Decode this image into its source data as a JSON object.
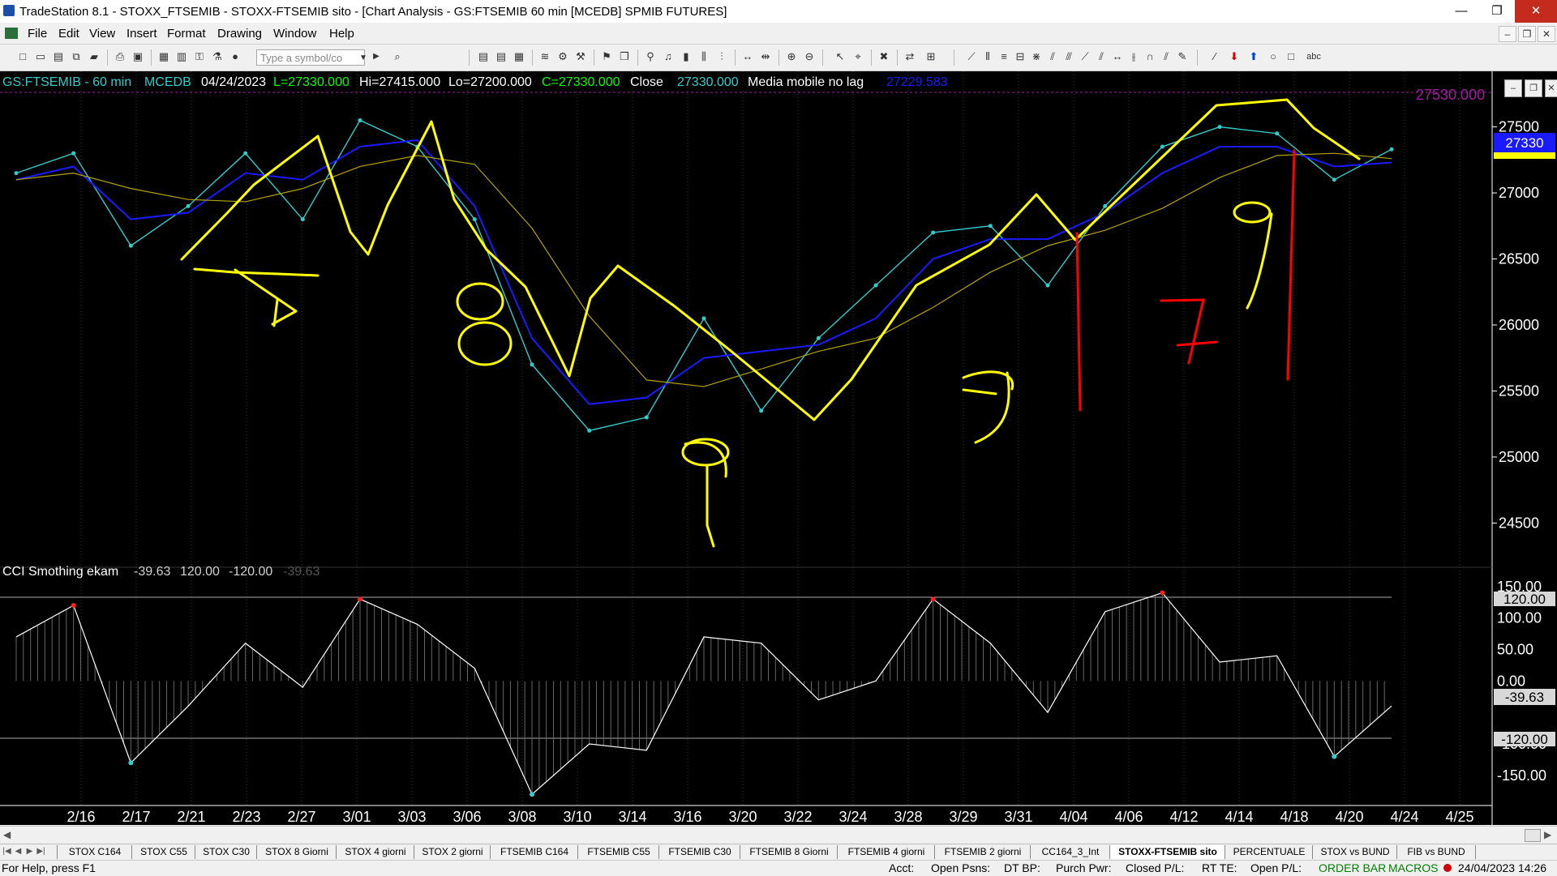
{
  "window": {
    "title": "TradeStation 8.1 - STOXX_FTSEMIB - STOXX-FTSEMIB sito - [Chart Analysis - GS:FTSEMIB  60 min  [MCEDB] SPMIB FUTURES]",
    "minimize": "—",
    "maximize": "❐",
    "close": "✕"
  },
  "menu": [
    "File",
    "Edit",
    "View",
    "Insert",
    "Format",
    "Drawing",
    "Window",
    "Help"
  ],
  "toolbar": {
    "symbol_placeholder": "Type a symbol/co",
    "text_tool": "abc"
  },
  "chart": {
    "header": {
      "symbol": "GS:FTSEMIB - 60 min",
      "tag": "MCEDB",
      "date": "04/24/2023",
      "last": "L=27330.000",
      "high": "Hi=27415.000",
      "low": "Lo=27200.000",
      "close": "C=27330.000",
      "close_label": "Close",
      "close_value": "27330.000",
      "indicator_label": "Media mobile no lag",
      "indicator_value": "27229.583"
    },
    "price_axis": [
      "27500",
      "27000",
      "26500",
      "26000",
      "25500",
      "25000",
      "24500"
    ],
    "price_highlight": "27330",
    "resistance_label": "27530.000",
    "oscillator": {
      "header_name": "CCI Smothing ekam",
      "header_values": [
        "-39.63",
        "120.00",
        "-120.00",
        "-39.63"
      ],
      "axis": [
        "150.00",
        "100.00",
        "50.00",
        "0.00",
        "-100.00",
        "-150.00"
      ],
      "markers": [
        "120.00",
        "-39.63",
        "-120.00"
      ]
    },
    "date_axis": [
      "2/16",
      "2/17",
      "2/21",
      "2/23",
      "2/27",
      "3/01",
      "3/03",
      "3/06",
      "3/08",
      "3/10",
      "3/14",
      "3/16",
      "3/20",
      "3/22",
      "3/24",
      "3/28",
      "3/29",
      "3/31",
      "4/04",
      "4/06",
      "4/12",
      "4/14",
      "4/18",
      "4/20",
      "4/24",
      "4/25"
    ],
    "colors": {
      "price": "#33cccc",
      "ma_fast": "#1a1aff",
      "ma_slow": "#b3a300",
      "annotation_yellow": "#ffff00",
      "annotation_red": "#ff0000",
      "cci_line": "#ffffff",
      "cci_high": "#ff2020",
      "cci_low": "#33cccc"
    },
    "chart_data": {
      "type": "line",
      "title": "GS:FTSEMIB - 60 min",
      "x": [
        "2/16",
        "2/17",
        "2/21",
        "2/23",
        "2/27",
        "3/01",
        "3/03",
        "3/06",
        "3/08",
        "3/10",
        "3/14",
        "3/16",
        "3/20",
        "3/22",
        "3/24",
        "3/28",
        "3/29",
        "3/31",
        "4/04",
        "4/06",
        "4/12",
        "4/14",
        "4/18",
        "4/20",
        "4/24"
      ],
      "series": [
        {
          "name": "GS:FTSEMIB",
          "values": [
            27150,
            27300,
            26600,
            26900,
            27300,
            26800,
            27550,
            27350,
            26800,
            25700,
            25200,
            25300,
            26050,
            25350,
            25900,
            26300,
            26700,
            26750,
            26300,
            26900,
            27350,
            27500,
            27450,
            27100,
            27330
          ]
        },
        {
          "name": "Media mobile no lag",
          "values": [
            27100,
            27200,
            26800,
            26850,
            27150,
            27100,
            27350,
            27400,
            26900,
            25900,
            25400,
            25450,
            25750,
            25800,
            25850,
            26050,
            26500,
            26650,
            26650,
            26850,
            27150,
            27350,
            27350,
            27200,
            27230
          ]
        }
      ],
      "ylim": [
        24300,
        27700
      ]
    },
    "cci_data": {
      "type": "line",
      "title": "CCI Smothing ekam",
      "x": [
        "2/16",
        "2/17",
        "2/21",
        "2/23",
        "2/27",
        "3/01",
        "3/03",
        "3/06",
        "3/08",
        "3/10",
        "3/14",
        "3/16",
        "3/20",
        "3/22",
        "3/24",
        "3/28",
        "3/29",
        "3/31",
        "4/04",
        "4/06",
        "4/12",
        "4/14",
        "4/18",
        "4/20",
        "4/24"
      ],
      "values": [
        70,
        120,
        -130,
        -40,
        60,
        -10,
        130,
        90,
        20,
        -180,
        -100,
        -110,
        70,
        60,
        -30,
        0,
        130,
        60,
        -50,
        110,
        140,
        30,
        40,
        -120,
        -39.63
      ],
      "ylim": [
        -190,
        160
      ]
    }
  },
  "annotations": [
    "7",
    "8",
    "9",
    "5",
    "7",
    "9"
  ],
  "tabs": [
    "STOX C164",
    "STOX C55",
    "STOX C30",
    "STOX 8 Giorni",
    "STOX 4 giorni",
    "STOX 2 giorni",
    "FTSEMIB C164",
    "FTSEMIB C55",
    "FTSEMIB C30",
    "FTSEMIB 8 Giorni",
    "FTSEMIB 4 giorni",
    "FTSEMIB 2 giorni",
    "CC164_3_Int",
    "STOXX-FTSEMIB sito",
    "PERCENTUALE",
    "STOX vs BUND",
    "FIB vs BUND"
  ],
  "active_tab": "STOXX-FTSEMIB sito",
  "status": {
    "help": "For Help, press F1",
    "acct": "Acct:",
    "open_psns": "Open Psns:",
    "dt_bp": "DT BP:",
    "purch_pwr": "Purch Pwr:",
    "closed_pl": "Closed P/L:",
    "rt_te": "RT TE:",
    "open_pl": "Open P/L:",
    "order_bar": "ORDER BAR",
    "macros": "MACROS",
    "datetime": "24/04/2023 14:26"
  }
}
